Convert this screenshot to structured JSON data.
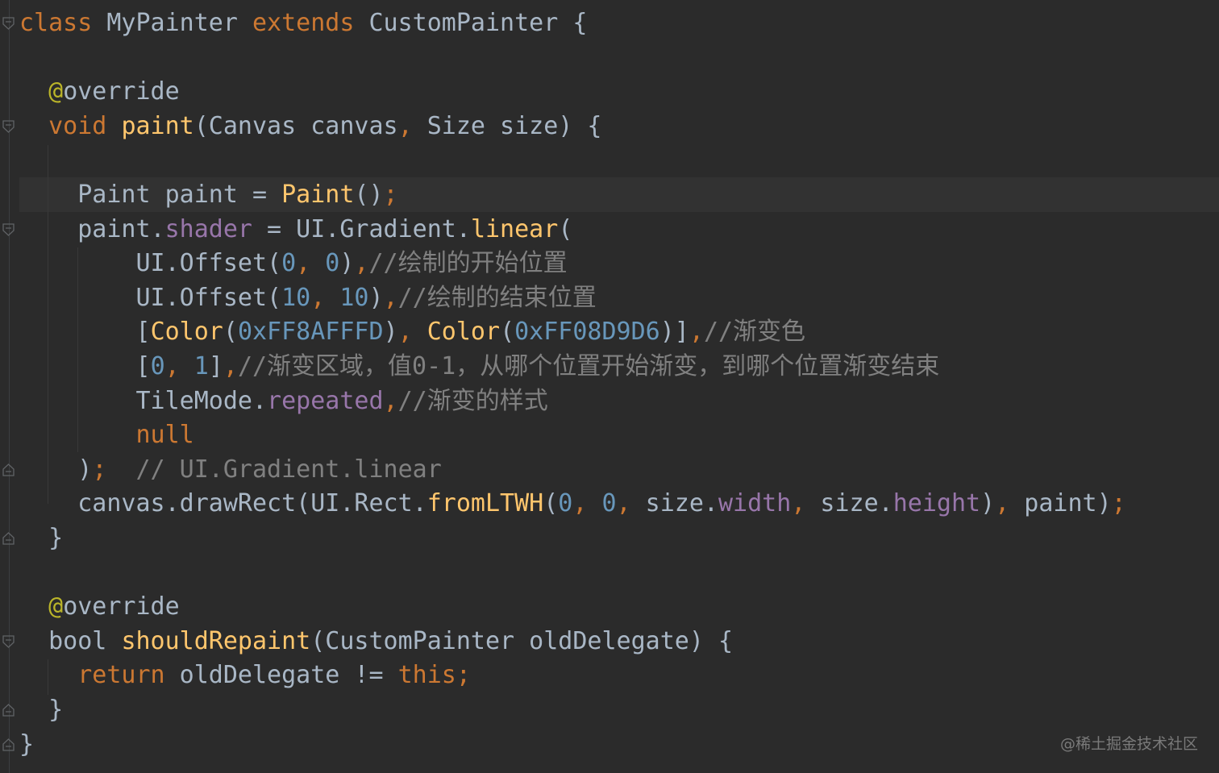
{
  "code_lines": [
    [
      [
        "class",
        "kw"
      ],
      [
        " MyPainter ",
        "plain"
      ],
      [
        "extends",
        "kw"
      ],
      [
        " CustomPainter {",
        "plain"
      ]
    ],
    [],
    [
      [
        "  ",
        "plain"
      ],
      [
        "@",
        "anno-at"
      ],
      [
        "override",
        "anno"
      ]
    ],
    [
      [
        "  ",
        "plain"
      ],
      [
        "void",
        "kw"
      ],
      [
        " ",
        "plain"
      ],
      [
        "paint",
        "fn"
      ],
      [
        "(Canvas canvas",
        "plain"
      ],
      [
        ",",
        "kw"
      ],
      [
        " Size size) {",
        "plain"
      ]
    ],
    [],
    [
      [
        "    Paint paint = ",
        "plain"
      ],
      [
        "Paint",
        "fn"
      ],
      [
        "()",
        "plain"
      ],
      [
        ";",
        "kw"
      ]
    ],
    [
      [
        "    paint.",
        "plain"
      ],
      [
        "shader",
        "prop"
      ],
      [
        " = UI.Gradient.",
        "plain"
      ],
      [
        "linear",
        "fn"
      ],
      [
        "(",
        "plain"
      ]
    ],
    [
      [
        "        UI.Offset(",
        "plain"
      ],
      [
        "0",
        "num"
      ],
      [
        ", ",
        "kw"
      ],
      [
        "0",
        "num"
      ],
      [
        ")",
        "plain"
      ],
      [
        ",",
        "kw"
      ],
      [
        "//绘制的开始位置",
        "cmt"
      ]
    ],
    [
      [
        "        UI.Offset(",
        "plain"
      ],
      [
        "10",
        "num"
      ],
      [
        ", ",
        "kw"
      ],
      [
        "10",
        "num"
      ],
      [
        ")",
        "plain"
      ],
      [
        ",",
        "kw"
      ],
      [
        "//绘制的结束位置",
        "cmt"
      ]
    ],
    [
      [
        "        [",
        "plain"
      ],
      [
        "Color",
        "fn"
      ],
      [
        "(",
        "plain"
      ],
      [
        "0xFF8AFFFD",
        "num"
      ],
      [
        ")",
        "plain"
      ],
      [
        ", ",
        "kw"
      ],
      [
        "Color",
        "fn"
      ],
      [
        "(",
        "plain"
      ],
      [
        "0xFF08D9D6",
        "num"
      ],
      [
        ")]",
        "plain"
      ],
      [
        ",",
        "kw"
      ],
      [
        "//渐变色",
        "cmt"
      ]
    ],
    [
      [
        "        [",
        "plain"
      ],
      [
        "0",
        "num"
      ],
      [
        ", ",
        "kw"
      ],
      [
        "1",
        "num"
      ],
      [
        "]",
        "plain"
      ],
      [
        ",",
        "kw"
      ],
      [
        "//渐变区域，值0-1，从哪个位置开始渐变，到哪个位置渐变结束",
        "cmt"
      ]
    ],
    [
      [
        "        TileMode.",
        "plain"
      ],
      [
        "repeated",
        "prop"
      ],
      [
        ",",
        "kw"
      ],
      [
        "//渐变的样式",
        "cmt"
      ]
    ],
    [
      [
        "        ",
        "plain"
      ],
      [
        "null",
        "kw"
      ]
    ],
    [
      [
        "    )",
        "plain"
      ],
      [
        ";",
        "kw"
      ],
      [
        "  // UI.Gradient.linear",
        "cmt"
      ]
    ],
    [
      [
        "    canvas.drawRect(UI.Rect.",
        "plain"
      ],
      [
        "fromLTWH",
        "fn"
      ],
      [
        "(",
        "plain"
      ],
      [
        "0",
        "num"
      ],
      [
        ", ",
        "kw"
      ],
      [
        "0",
        "num"
      ],
      [
        ", ",
        "kw"
      ],
      [
        "size.",
        "plain"
      ],
      [
        "width",
        "prop"
      ],
      [
        ", ",
        "kw"
      ],
      [
        "size.",
        "plain"
      ],
      [
        "height",
        "prop"
      ],
      [
        ")",
        "plain"
      ],
      [
        ", ",
        "kw"
      ],
      [
        "paint)",
        "plain"
      ],
      [
        ";",
        "kw"
      ]
    ],
    [
      [
        "  }",
        "plain"
      ]
    ],
    [],
    [
      [
        "  ",
        "plain"
      ],
      [
        "@",
        "anno-at"
      ],
      [
        "override",
        "anno"
      ]
    ],
    [
      [
        "  bool ",
        "plain"
      ],
      [
        "shouldRepaint",
        "fn"
      ],
      [
        "(CustomPainter oldDelegate) {",
        "plain"
      ]
    ],
    [
      [
        "    ",
        "plain"
      ],
      [
        "return",
        "kw"
      ],
      [
        " oldDelegate != ",
        "plain"
      ],
      [
        "this",
        "kw"
      ],
      [
        ";",
        "kw"
      ]
    ],
    [
      [
        "  }",
        "plain"
      ]
    ],
    [
      [
        "}",
        "plain"
      ]
    ]
  ],
  "fold_markers": [
    "open",
    "open",
    "open",
    "close",
    "close",
    "open",
    "close",
    "close"
  ],
  "watermark": "@稀土掘金技术社区",
  "colors": {
    "background": "#2b2b2b",
    "current_line": "#323232",
    "keyword": "#cc7832",
    "function": "#ffc66d",
    "number": "#6897bb",
    "property": "#9876aa",
    "comment": "#808080",
    "annotation": "#bbb529",
    "plain": "#a9b7c6"
  }
}
